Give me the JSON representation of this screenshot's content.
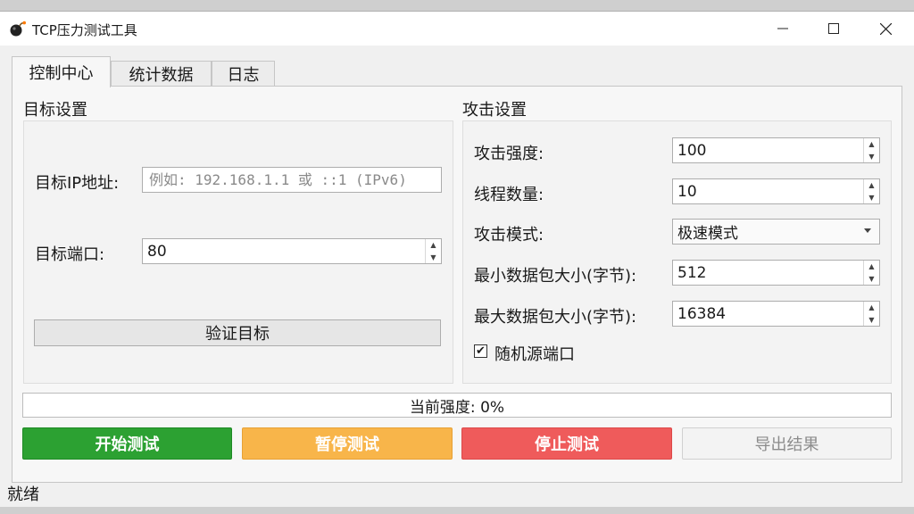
{
  "window": {
    "title": "TCP压力测试工具",
    "icon": "bomb-icon",
    "controls": [
      "minimize-icon",
      "maximize-icon",
      "close-icon"
    ]
  },
  "tabs": [
    {
      "label": "控制中心",
      "active": true
    },
    {
      "label": "统计数据",
      "active": false
    },
    {
      "label": "日志",
      "active": false
    }
  ],
  "target": {
    "section_title": "目标设置",
    "ip_label": "目标IP地址:",
    "ip_value": "",
    "ip_placeholder": "例如: 192.168.1.1 或 ::1 (IPv6)",
    "port_label": "目标端口:",
    "port_value": "80",
    "verify_button": "验证目标"
  },
  "attack": {
    "section_title": "攻击设置",
    "intensity_label": "攻击强度:",
    "intensity_value": "100",
    "threads_label": "线程数量:",
    "threads_value": "10",
    "mode_label": "攻击模式:",
    "mode_value": "极速模式",
    "min_packet_label": "最小数据包大小(字节):",
    "min_packet_value": "512",
    "max_packet_label": "最大数据包大小(字节):",
    "max_packet_value": "16384",
    "random_port_label": "随机源端口",
    "random_port_checked": true
  },
  "progress": {
    "text": "当前强度: 0%",
    "percent": 0,
    "fill_color": "#06b025"
  },
  "actions": {
    "start": {
      "label": "开始测试",
      "color": "#2ca132"
    },
    "pause": {
      "label": "暂停测试",
      "color": "#f8b54a"
    },
    "stop": {
      "label": "停止测试",
      "color": "#ef5b5b"
    },
    "export": {
      "label": "导出结果",
      "enabled": false
    }
  },
  "status": "就绪"
}
